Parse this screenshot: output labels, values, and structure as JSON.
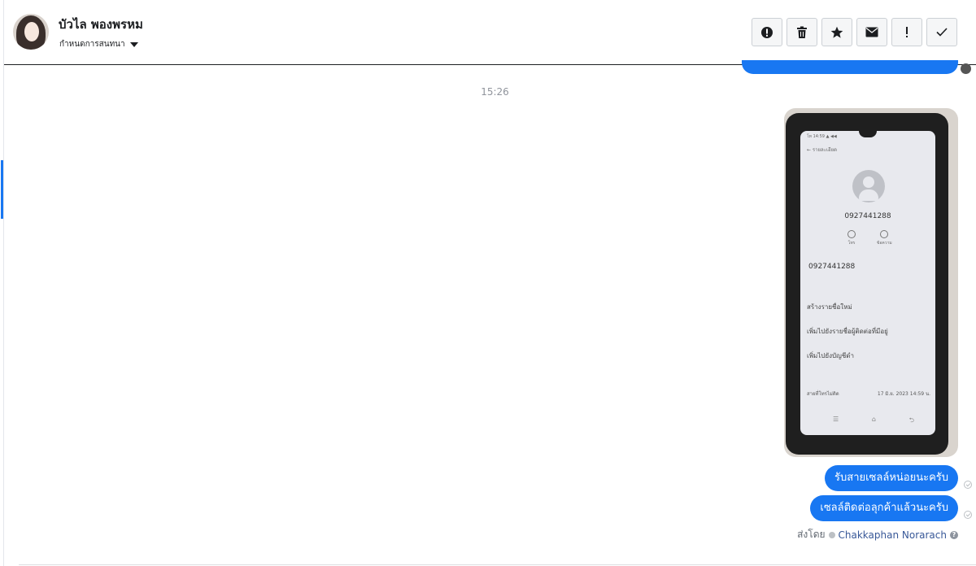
{
  "header": {
    "contact_name": "บัวไล พองพรหม",
    "assign_label": "กำหนดการสนทนา",
    "toolbar": [
      {
        "icon": "alert-circle-icon",
        "label": "Mark as spam"
      },
      {
        "icon": "trash-icon",
        "label": "Delete"
      },
      {
        "icon": "star-icon",
        "label": "Star"
      },
      {
        "icon": "envelope-icon",
        "label": "Mark as unread"
      },
      {
        "icon": "exclamation-icon",
        "label": "Follow up"
      },
      {
        "icon": "checkmark-icon",
        "label": "Mark as done"
      }
    ]
  },
  "thread": {
    "timestamp": "15:26",
    "photo_screen": {
      "status_bar": "โท 14:59 ▲ ◀◀",
      "back_label": "← รายละเอียด",
      "number_top": "0927441288",
      "actions": [
        "โทร",
        "ข้อความ"
      ],
      "number_2": "0927441288",
      "rows": [
        "สร้างรายชื่อใหม่",
        "เพิ่มไปยังรายชื่อผู้ติดต่อที่มีอยู่",
        "เพิ่มไปยังบัญชีดำ"
      ],
      "footer_left": "สายที่โทรไม่ติด",
      "footer_right": "17 มิ.ย. 2023 14:59 น.",
      "nav": [
        "☰",
        "⌂",
        "⮌"
      ]
    },
    "messages": [
      {
        "text": "รับสายเซลล์หน่อยนะครับ"
      },
      {
        "text": "เซลล์ติดต่อลุกค้าแล้วนะครับ"
      }
    ],
    "sent_by_label": "ส่งโดย",
    "sent_by_agent": "Chakkaphan Norarach",
    "help_glyph": "?"
  },
  "colors": {
    "accent": "#1877f2",
    "bubble_text": "#ffffff",
    "timestamp": "#90949c"
  }
}
